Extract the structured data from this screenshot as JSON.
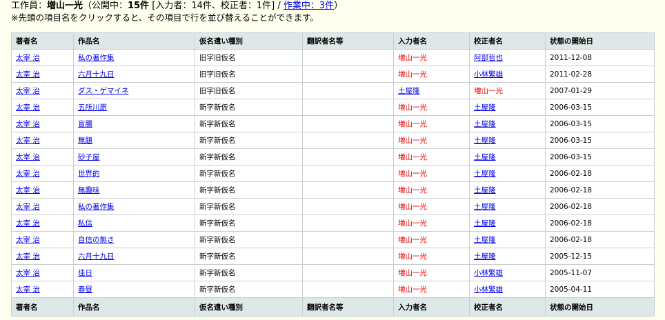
{
  "header": {
    "prefix": "工作員：",
    "name": "増山一光",
    "open_paren": "（公開中：",
    "public_count": "15件",
    "bracket_text": " [入力者：14件、校正者：1件] / ",
    "working_link": "作業中：3件",
    "close_paren": "）",
    "note": "※先頭の項目名をクリックすると、その項目で行を並び替えることができます。"
  },
  "columns": [
    "著者名",
    "作品名",
    "仮名遣い種別",
    "翻訳者名等",
    "入力者名",
    "校正者名",
    "状態の開始日"
  ],
  "rows": [
    {
      "author": "太宰 治",
      "title": "私の著作集",
      "kana": "旧字旧仮名",
      "translator": "",
      "input": "増山一光",
      "proof": "阿部哲也",
      "date": "2011-12-08",
      "input_red": true,
      "proof_red": false
    },
    {
      "author": "太宰 治",
      "title": "六月十九日",
      "kana": "旧字旧仮名",
      "translator": "",
      "input": "増山一光",
      "proof": "小林繁雄",
      "date": "2011-02-28",
      "input_red": true,
      "proof_red": false
    },
    {
      "author": "太宰 治",
      "title": "ダス・ゲマイネ",
      "kana": "旧字旧仮名",
      "translator": "",
      "input": "土屋隆",
      "proof": "増山一光",
      "date": "2007-01-29",
      "input_red": false,
      "proof_red": true
    },
    {
      "author": "太宰 治",
      "title": "五所川原",
      "kana": "新字新仮名",
      "translator": "",
      "input": "増山一光",
      "proof": "土屋隆",
      "date": "2006-03-15",
      "input_red": true,
      "proof_red": false
    },
    {
      "author": "太宰 治",
      "title": "盲腸",
      "kana": "新字新仮名",
      "translator": "",
      "input": "増山一光",
      "proof": "土屋隆",
      "date": "2006-03-15",
      "input_red": true,
      "proof_red": false
    },
    {
      "author": "太宰 治",
      "title": "無題",
      "kana": "新字新仮名",
      "translator": "",
      "input": "増山一光",
      "proof": "土屋隆",
      "date": "2006-03-15",
      "input_red": true,
      "proof_red": false
    },
    {
      "author": "太宰 治",
      "title": "砂子屋",
      "kana": "新字新仮名",
      "translator": "",
      "input": "増山一光",
      "proof": "土屋隆",
      "date": "2006-03-15",
      "input_red": true,
      "proof_red": false
    },
    {
      "author": "太宰 治",
      "title": "世界的",
      "kana": "新字新仮名",
      "translator": "",
      "input": "増山一光",
      "proof": "土屋隆",
      "date": "2006-02-18",
      "input_red": true,
      "proof_red": false
    },
    {
      "author": "太宰 治",
      "title": "無趣味",
      "kana": "新字新仮名",
      "translator": "",
      "input": "増山一光",
      "proof": "土屋隆",
      "date": "2006-02-18",
      "input_red": true,
      "proof_red": false
    },
    {
      "author": "太宰 治",
      "title": "私の著作集",
      "kana": "新字新仮名",
      "translator": "",
      "input": "増山一光",
      "proof": "土屋隆",
      "date": "2006-02-18",
      "input_red": true,
      "proof_red": false
    },
    {
      "author": "太宰 治",
      "title": "私信",
      "kana": "新字新仮名",
      "translator": "",
      "input": "増山一光",
      "proof": "土屋隆",
      "date": "2006-02-18",
      "input_red": true,
      "proof_red": false
    },
    {
      "author": "太宰 治",
      "title": "自信の無さ",
      "kana": "新字新仮名",
      "translator": "",
      "input": "増山一光",
      "proof": "土屋隆",
      "date": "2006-02-18",
      "input_red": true,
      "proof_red": false
    },
    {
      "author": "太宰 治",
      "title": "六月十九日",
      "kana": "新字新仮名",
      "translator": "",
      "input": "増山一光",
      "proof": "土屋隆",
      "date": "2005-12-15",
      "input_red": true,
      "proof_red": false
    },
    {
      "author": "太宰 治",
      "title": "佳日",
      "kana": "新字新仮名",
      "translator": "",
      "input": "増山一光",
      "proof": "小林繁雄",
      "date": "2005-11-07",
      "input_red": true,
      "proof_red": false
    },
    {
      "author": "太宰 治",
      "title": "春昼",
      "kana": "新字新仮名",
      "translator": "",
      "input": "増山一光",
      "proof": "小林繁雄",
      "date": "2005-04-11",
      "input_red": true,
      "proof_red": false
    }
  ],
  "colors": {
    "link": "#0000ee",
    "self_name": "#ee0000",
    "header_bg": "#dfe8e8",
    "page_bg": "#fffff0"
  }
}
